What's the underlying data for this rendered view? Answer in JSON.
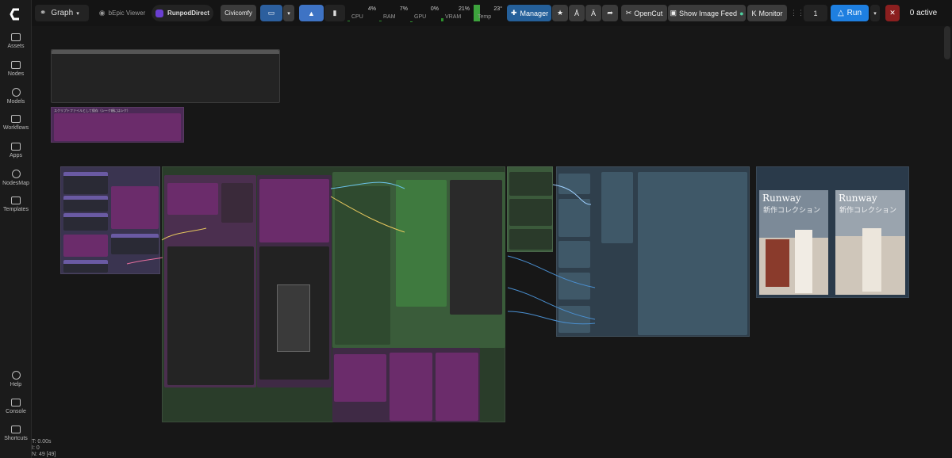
{
  "sidebar": {
    "items": [
      {
        "label": "Assets",
        "icon": "image-icon"
      },
      {
        "label": "Nodes",
        "icon": "nodes-icon"
      },
      {
        "label": "Models",
        "icon": "models-icon"
      },
      {
        "label": "Workflows",
        "icon": "workflows-icon"
      },
      {
        "label": "Apps",
        "icon": "apps-icon"
      },
      {
        "label": "NodesMap",
        "icon": "map-icon"
      },
      {
        "label": "Templates",
        "icon": "templates-icon"
      }
    ],
    "bottom": [
      {
        "label": "Help",
        "icon": "help-icon"
      },
      {
        "label": "Console",
        "icon": "console-icon"
      },
      {
        "label": "Shortcuts",
        "icon": "keyboard-icon"
      }
    ]
  },
  "topbar": {
    "graph_label": "Graph",
    "viewer_label": "bEpic Viewer",
    "runpod_label": "RunpodDirect",
    "civicomfy_label": "Civicomfy",
    "stats": [
      {
        "label": "CPU",
        "value": "4%",
        "fill": 0.04
      },
      {
        "label": "RAM",
        "value": "7%",
        "fill": 0.07
      },
      {
        "label": "GPU",
        "value": "0%",
        "fill": 0.0
      },
      {
        "label": "VRAM",
        "value": "21%",
        "fill": 0.21
      },
      {
        "label": "Temp",
        "value": "23°",
        "fill": 0.23
      }
    ],
    "manager_label": "Manager",
    "opencut_label": "OpenCut",
    "feed_label": "Show Image Feed",
    "monitor_label": "Monitor",
    "queue_count": "1",
    "run_label": "Run",
    "active_label": "0 active"
  },
  "canvas": {
    "group_title": "スクリプトファイルとして保存（シーク順にはシク）",
    "images": [
      {
        "title": "Runway",
        "subtitle": "新作コレクション"
      },
      {
        "title": "Runway",
        "subtitle": "新作コレクション"
      }
    ]
  },
  "status": {
    "t": "T: 0.00s",
    "i": "I: 0",
    "n": "N: 49 [49]"
  },
  "colors": {
    "accent": "#1e7fe0",
    "purple_node": "#6b2c6b",
    "green_group": "#2e4a2e",
    "blue_group": "#2f3f4c"
  }
}
